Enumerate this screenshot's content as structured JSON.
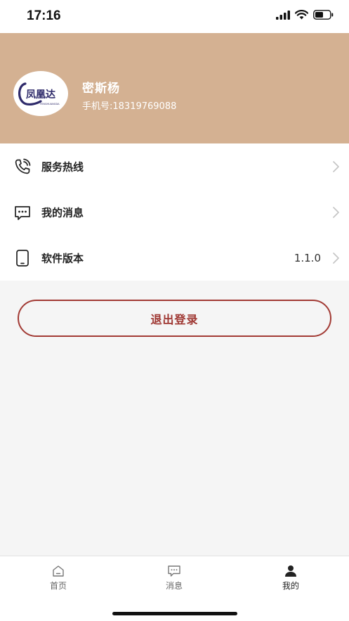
{
  "status_bar": {
    "time": "17:16"
  },
  "profile": {
    "avatar_logo_text": "凤凰达",
    "avatar_logo_subtext": "FENGHUANGDA",
    "name": "密斯杨",
    "phone": "手机号:18319769088"
  },
  "menu": {
    "items": [
      {
        "label": "服务热线",
        "icon": "phone-icon",
        "value": ""
      },
      {
        "label": "我的消息",
        "icon": "message-icon",
        "value": ""
      },
      {
        "label": "软件版本",
        "icon": "mobile-device-icon",
        "value": "1.1.0"
      }
    ]
  },
  "logout": {
    "label": "退出登录"
  },
  "tabs": [
    {
      "label": "首页",
      "icon": "home-icon",
      "active": false
    },
    {
      "label": "消息",
      "icon": "chat-icon",
      "active": false
    },
    {
      "label": "我的",
      "icon": "person-icon",
      "active": true
    }
  ],
  "colors": {
    "header_bg": "#d4b192",
    "accent": "#9e3631",
    "page_bg": "#f5f5f5"
  }
}
